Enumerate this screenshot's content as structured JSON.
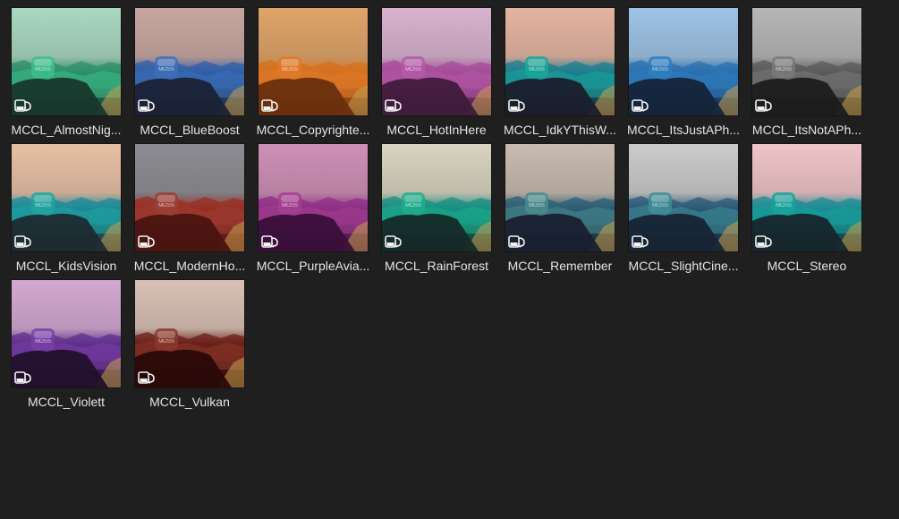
{
  "presets": [
    {
      "label": "MCCL_AlmostNig...",
      "thumb_icon": "lut-preset-icon",
      "tint": "#3cbf8a",
      "sky": "#a9d8c0",
      "mid": "#2e8f6a",
      "ground": "#18382c"
    },
    {
      "label": "MCCL_BlueBoost",
      "thumb_icon": "lut-preset-icon",
      "tint": "#3f6fb8",
      "sky": "#c8a6a0",
      "mid": "#2f5fa8",
      "ground": "#1b2236"
    },
    {
      "label": "MCCL_Copyrighte...",
      "thumb_icon": "lut-preset-icon",
      "tint": "#e07a2a",
      "sky": "#e0a468",
      "mid": "#d4711f",
      "ground": "#6a2f0e"
    },
    {
      "label": "MCCL_HotInHere",
      "thumb_icon": "lut-preset-icon",
      "tint": "#b45aa8",
      "sky": "#d9b2cf",
      "mid": "#a54b98",
      "ground": "#3f1b3c"
    },
    {
      "label": "MCCL_IdkYThisW...",
      "thumb_icon": "lut-preset-icon",
      "tint": "#1aa79a",
      "sky": "#e5b4a0",
      "mid": "#1c7d8f",
      "ground": "#1a1f2c"
    },
    {
      "label": "MCCL_ItsJustAPh...",
      "thumb_icon": "lut-preset-icon",
      "tint": "#2f7ec0",
      "sky": "#9ec3e6",
      "mid": "#2a6fae",
      "ground": "#14243a"
    },
    {
      "label": "MCCL_ItsNotAPh...",
      "thumb_icon": "lut-preset-icon",
      "tint": "#7a7a7a",
      "sky": "#b6b6b6",
      "mid": "#5a5a5a",
      "ground": "#1c1c1c"
    },
    {
      "label": "MCCL_KidsVision",
      "thumb_icon": "lut-preset-icon",
      "tint": "#20a5a0",
      "sky": "#e8c0a4",
      "mid": "#1c8a9a",
      "ground": "#1e2a30"
    },
    {
      "label": "MCCL_ModernHo...",
      "thumb_icon": "lut-preset-icon",
      "tint": "#9a4036",
      "sky": "#8d8c92",
      "mid": "#9a2f24",
      "ground": "#4a1410"
    },
    {
      "label": "MCCL_PurpleAvia...",
      "thumb_icon": "lut-preset-icon",
      "tint": "#a43f92",
      "sky": "#cf8fb6",
      "mid": "#8f2f86",
      "ground": "#3a0f3a"
    },
    {
      "label": "MCCL_RainForest",
      "thumb_icon": "lut-preset-icon",
      "tint": "#1fae8c",
      "sky": "#d8d4c0",
      "mid": "#178f82",
      "ground": "#142a28"
    },
    {
      "label": "MCCL_Remember",
      "thumb_icon": "lut-preset-icon",
      "tint": "#4a8c8c",
      "sky": "#c8bbb0",
      "mid": "#2b5e74",
      "ground": "#192030"
    },
    {
      "label": "MCCL_SlightCine...",
      "thumb_icon": "lut-preset-icon",
      "tint": "#3f8f98",
      "sky": "#cbcbcb",
      "mid": "#2a5a78",
      "ground": "#172434"
    },
    {
      "label": "MCCL_Stereo",
      "thumb_icon": "lut-preset-icon",
      "tint": "#18a39a",
      "sky": "#f0c4c8",
      "mid": "#1b8c94",
      "ground": "#16262c"
    },
    {
      "label": "MCCL_Violett",
      "thumb_icon": "lut-preset-icon",
      "tint": "#7a3fa8",
      "sky": "#d3a8d2",
      "mid": "#5f2f8c",
      "ground": "#22102c"
    },
    {
      "label": "MCCL_Vulkan",
      "thumb_icon": "lut-preset-icon",
      "tint": "#8a3a2a",
      "sky": "#d9c0b4",
      "mid": "#6a1f18",
      "ground": "#2a0a08"
    }
  ]
}
